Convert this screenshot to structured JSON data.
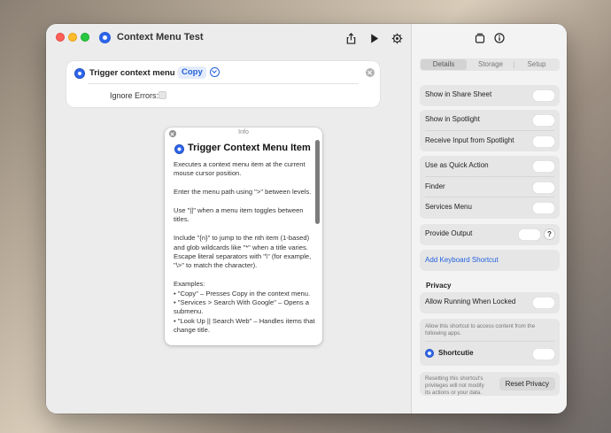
{
  "window": {
    "title": "Context Menu Test"
  },
  "toolbar": {
    "share_icon": "share-icon",
    "run_icon": "play-icon",
    "settings_icon": "gear-icon"
  },
  "action": {
    "title": "Trigger context menu item",
    "param": "Copy",
    "ignore_errors_label": "Ignore Errors:"
  },
  "info": {
    "header": "Info",
    "title": "Trigger Context Menu Item",
    "paragraphs": [
      "Executes a context menu item at the current mouse cursor position.",
      "Enter the menu path using \">\" between levels.",
      "Use \"||\" when a menu item toggles between titles.",
      "Include \"{n}\" to jump to the nth item (1-based) and glob wildcards like \"*\" when a title varies. Escape literal separators with \"\\\" (for example, \"\\>\" to match the character).",
      "Examples:",
      "• \"Copy\" – Presses Copy in the context menu.",
      "• \"Services > Search With Google\" – Opens a submenu.",
      "• \"Look Up || Search Web\" – Handles items that change title."
    ]
  },
  "sidebar": {
    "tabs": [
      "Details",
      "Storage",
      "Setup"
    ],
    "rows": {
      "share_sheet": "Show in Share Sheet",
      "spotlight": "Show in Spotlight",
      "receive_spotlight": "Receive Input from Spotlight",
      "quick_action": "Use as Quick Action",
      "finder": "Finder",
      "services": "Services Menu",
      "provide_output": "Provide Output",
      "add_shortcut": "Add Keyboard Shortcut"
    },
    "help_glyph": "?",
    "privacy": {
      "header": "Privacy",
      "locked": "Allow Running When Locked",
      "note": "Allow this shortcut to access content from the following apps.",
      "app": "Shortcutie",
      "reset_note": "Resetting this shortcut's privileges will not modify its actions or your data.",
      "reset_button": "Reset Privacy"
    }
  }
}
